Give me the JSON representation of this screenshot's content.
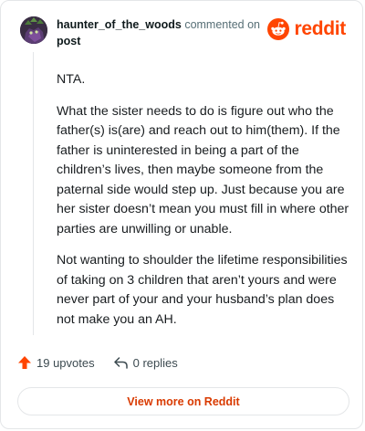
{
  "header": {
    "username": "haunter_of_the_woods",
    "action_text": "commented on",
    "post_link": "post",
    "brand": "reddit"
  },
  "comment": {
    "paragraphs": [
      "NTA.",
      "What the sister needs to do is figure out who the father(s) is(are) and reach out to him(them). If the father is uninterested in being a part of the children’s lives, then maybe someone from the paternal side would step up. Just because you are her sister doesn’t mean you must fill in where other parties are unwilling or unable.",
      "Not wanting to shoulder the lifetime responsibilities of taking on 3 children that aren’t yours and were never part of your and your husband’s plan does not make you an AH."
    ]
  },
  "actions": {
    "upvotes_label": "19 upvotes",
    "replies_label": "0 replies"
  },
  "footer": {
    "view_more_label": "View more on Reddit"
  },
  "colors": {
    "brand": "#ff4500",
    "upvote": "#ff4500",
    "link_accent": "#d93a00",
    "muted_text": "#576f76",
    "border": "#e4e6e8"
  },
  "icons": {
    "avatar": "avatar",
    "logo": "reddit-snoo-icon",
    "upvote": "upvote-arrow-icon",
    "reply": "reply-arrow-icon"
  }
}
